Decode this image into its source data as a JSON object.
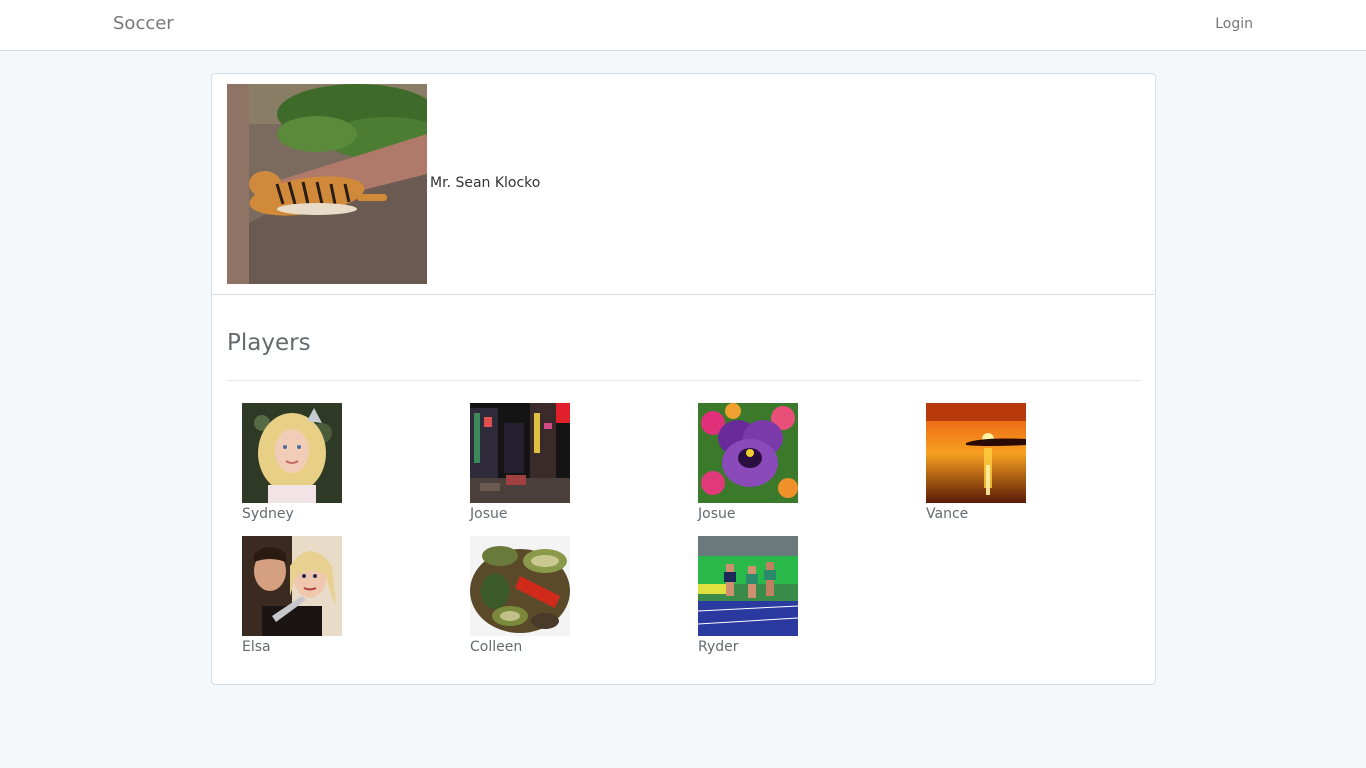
{
  "navbar": {
    "brand": "Soccer",
    "login_label": "Login"
  },
  "coach": {
    "name": "Mr. Sean Klocko",
    "photo_subject": "tiger-photo"
  },
  "players_section": {
    "title": "Players",
    "players": [
      {
        "name": "Sydney",
        "photo_subject": "girl-portrait"
      },
      {
        "name": "Josue",
        "photo_subject": "city-night"
      },
      {
        "name": "Josue",
        "photo_subject": "pansy-flower"
      },
      {
        "name": "Vance",
        "photo_subject": "sunset-water"
      },
      {
        "name": "Elsa",
        "photo_subject": "movie-couple"
      },
      {
        "name": "Colleen",
        "photo_subject": "grilled-vegetables"
      },
      {
        "name": "Ryder",
        "photo_subject": "track-runners"
      }
    ]
  },
  "colors": {
    "page_background": "#f5f8fa",
    "panel_border": "#d3e0e9",
    "text_muted": "#636b6f"
  }
}
